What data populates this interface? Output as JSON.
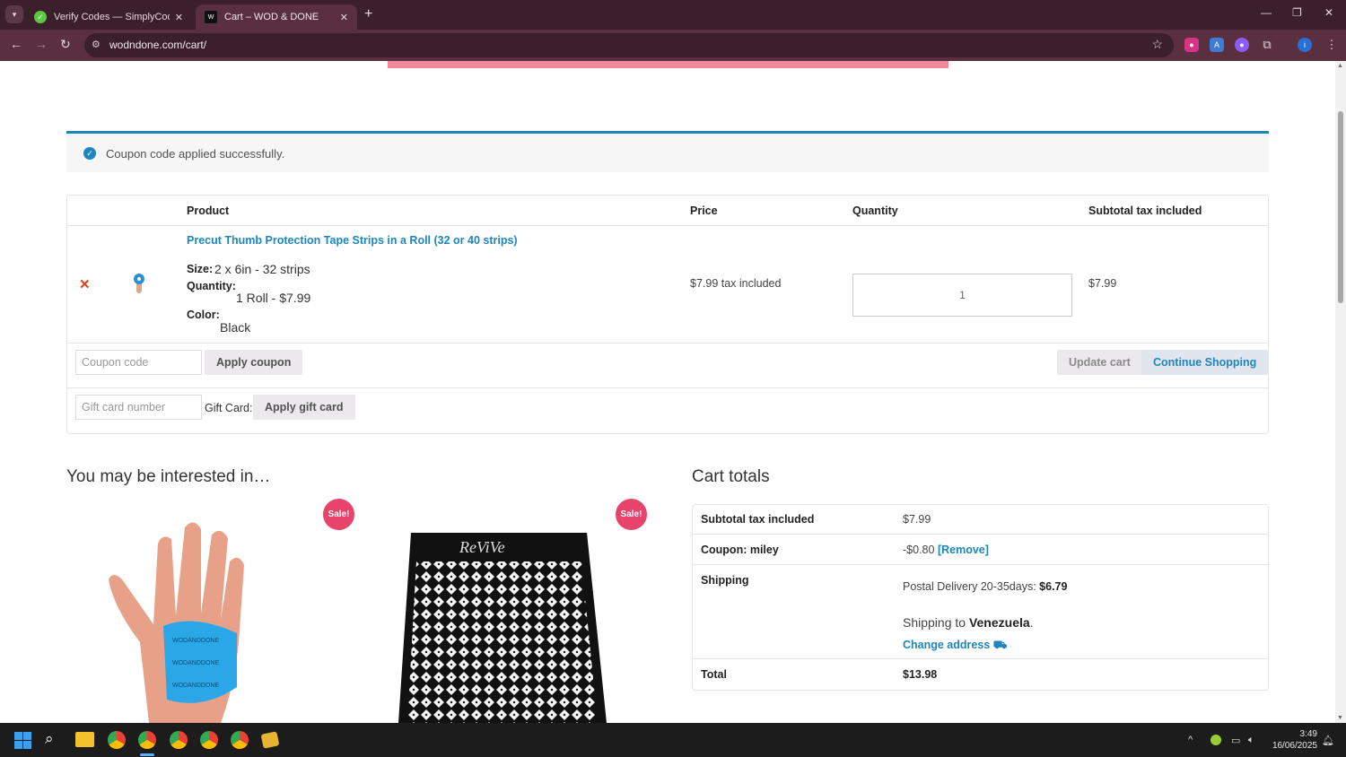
{
  "browser": {
    "tabs": [
      {
        "title": "Verify Codes — SimplyCodes",
        "active": false
      },
      {
        "title": "Cart – WOD & DONE",
        "active": true
      }
    ],
    "url": "wodndone.com/cart/"
  },
  "notice": {
    "text": "Coupon code applied successfully."
  },
  "cart": {
    "headers": {
      "product": "Product",
      "price": "Price",
      "quantity": "Quantity",
      "subtotal": "Subtotal tax included"
    },
    "item": {
      "name": "Precut Thumb Protection Tape Strips in a Roll (32 or 40 strips)",
      "size_label": "Size:",
      "size_value": "2 x 6in - 32 strips",
      "qty_label": "Quantity:",
      "qty_value": "1 Roll - $7.99",
      "color_label": "Color:",
      "color_value": "Black",
      "price": "$7.99 tax included",
      "quantity": "1",
      "subtotal": "$7.99"
    },
    "coupon_placeholder": "Coupon code",
    "apply_coupon": "Apply coupon",
    "update_cart": "Update cart",
    "continue_shopping": "Continue Shopping",
    "giftcard_placeholder": "Gift card number",
    "giftcard_label": "Gift Card:",
    "apply_giftcard": "Apply gift card"
  },
  "related": {
    "heading": "You may be interested in…",
    "sale_badge": "Sale!",
    "mat_brand": "ReViVe"
  },
  "totals": {
    "heading": "Cart totals",
    "subtotal_label": "Subtotal tax included",
    "subtotal_value": "$7.99",
    "coupon_label": "Coupon: miley",
    "coupon_value": "-$0.80",
    "remove": "[Remove]",
    "shipping_label": "Shipping",
    "shipping_method": "Postal Delivery 20-35days:",
    "shipping_cost": "$6.79",
    "shipping_to": "Shipping to",
    "country": "Venezuela",
    "change_address": "Change address",
    "total_label": "Total",
    "total_value": "$13.98"
  },
  "taskbar": {
    "time": "3:49",
    "date": "16/06/2025"
  },
  "colors": {
    "accent": "#1e85be",
    "sale": "#e8446b",
    "chrome": "#5a2f3f",
    "remove": "#e2401c"
  }
}
